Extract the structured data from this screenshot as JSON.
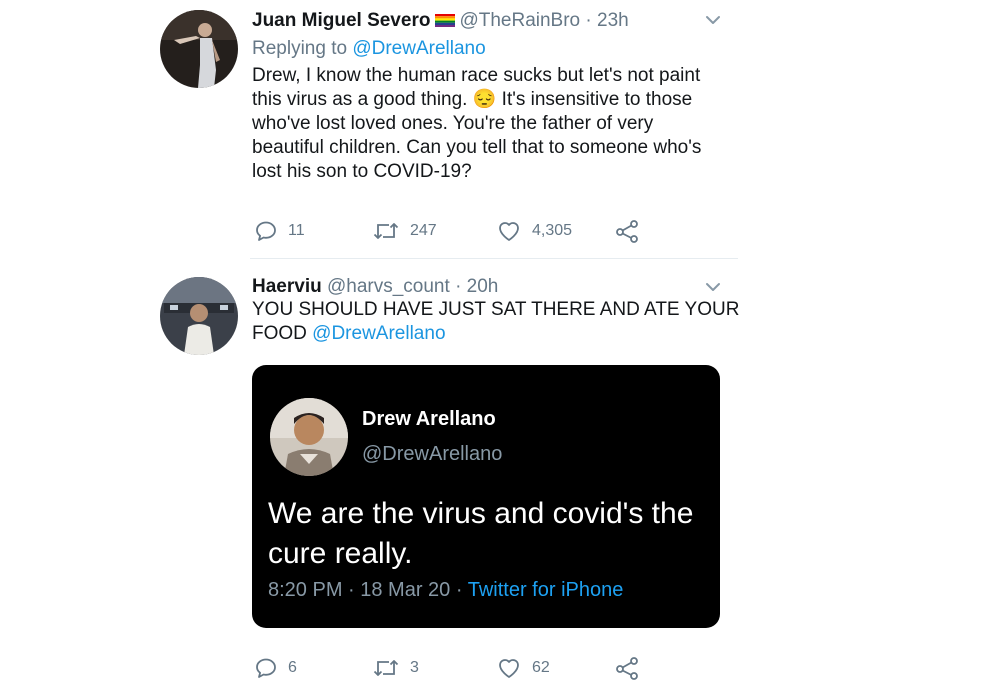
{
  "tweets": [
    {
      "name": "Juan Miguel Severo",
      "handle": "@TheRainBro",
      "separator": "·",
      "time": "23h",
      "replying_prefix": "Replying to",
      "replying_to": "@DrewArellano",
      "body_lines": [
        "Drew, I know the human race sucks but let's not paint",
        "this virus as a good thing. 😔 It's insensitive to those",
        "who've lost loved ones. You're the father of very",
        "beautiful children. Can you tell that to someone who's",
        "lost his son to COVID-19?"
      ],
      "replies": "11",
      "retweets": "247",
      "likes": "4,305"
    },
    {
      "name": "Haerviu",
      "handle": "@harvs_count",
      "separator": "·",
      "time": "20h",
      "body_line1": "YOU SHOULD HAVE JUST SAT THERE AND ATE YOUR",
      "body_line2_prefix": "FOOD ",
      "body_mention": "@DrewArellano",
      "quoted": {
        "name": "Drew Arellano",
        "handle": "@DrewArellano",
        "text_lines": [
          "We are the virus and covid's the",
          "cure really."
        ],
        "meta": "8:20 PM · 18 Mar 20 · ",
        "client": "Twitter for iPhone"
      },
      "replies": "6",
      "retweets": "3",
      "likes": "62"
    }
  ],
  "colors": {
    "link": "#1b95e0",
    "muted": "#657786",
    "card_bg": "#000000"
  }
}
